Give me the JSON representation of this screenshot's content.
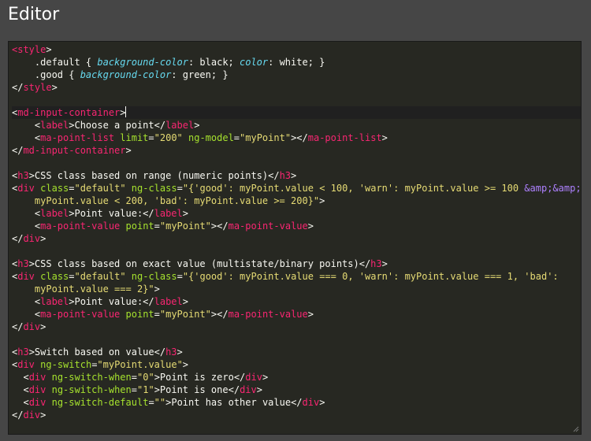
{
  "window": {
    "title": "Editor"
  },
  "editor": {
    "icons": {
      "resize_grip": "resize-grip-icon"
    },
    "colors": {
      "background": "#272822",
      "tag": "#f92672",
      "attribute": "#a6e22e",
      "string": "#e6db74",
      "property": "#66d9ef",
      "entity": "#ae81ff",
      "text": "#f8f8f2"
    },
    "active_line": 5,
    "lines": [
      [
        [
          "t",
          "<style"
        ],
        [
          "x",
          ">"
        ]
      ],
      [
        [
          "x",
          "    .default { "
        ],
        [
          "p",
          "background-color"
        ],
        [
          "x",
          ": black; "
        ],
        [
          "p",
          "color"
        ],
        [
          "x",
          ": white; }"
        ]
      ],
      [
        [
          "x",
          "    .good { "
        ],
        [
          "p",
          "background-color"
        ],
        [
          "x",
          ": green; }"
        ]
      ],
      [
        [
          "x",
          "</"
        ],
        [
          "t",
          "style"
        ],
        [
          "x",
          ">"
        ]
      ],
      [],
      [
        [
          "x",
          "<"
        ],
        [
          "t",
          "md-input-container"
        ],
        [
          "x",
          ">"
        ]
      ],
      [
        [
          "x",
          "    <"
        ],
        [
          "t",
          "label"
        ],
        [
          "x",
          ">Choose a point</"
        ],
        [
          "t",
          "label"
        ],
        [
          "x",
          ">"
        ]
      ],
      [
        [
          "x",
          "    <"
        ],
        [
          "t",
          "ma-point-list"
        ],
        [
          "x",
          " "
        ],
        [
          "a",
          "limit"
        ],
        [
          "x",
          "="
        ],
        [
          "s",
          "\"200\""
        ],
        [
          "x",
          " "
        ],
        [
          "a",
          "ng-model"
        ],
        [
          "x",
          "="
        ],
        [
          "s",
          "\"myPoint\""
        ],
        [
          "x",
          "></"
        ],
        [
          "t",
          "ma-point-list"
        ],
        [
          "x",
          ">"
        ]
      ],
      [
        [
          "x",
          "</"
        ],
        [
          "t",
          "md-input-container"
        ],
        [
          "x",
          ">"
        ]
      ],
      [],
      [
        [
          "x",
          "<"
        ],
        [
          "t",
          "h3"
        ],
        [
          "x",
          ">CSS class based on range (numeric points)</"
        ],
        [
          "t",
          "h3"
        ],
        [
          "x",
          ">"
        ]
      ],
      [
        [
          "x",
          "<"
        ],
        [
          "t",
          "div"
        ],
        [
          "x",
          " "
        ],
        [
          "a",
          "class"
        ],
        [
          "x",
          "="
        ],
        [
          "s",
          "\"default\""
        ],
        [
          "x",
          " "
        ],
        [
          "a",
          "ng-class"
        ],
        [
          "x",
          "="
        ],
        [
          "s",
          "\"{'good': myPoint.value < 100, 'warn': myPoint.value >= 100 "
        ],
        [
          "e",
          "&amp;&amp;"
        ]
      ],
      [
        [
          "s",
          "    myPoint.value < 200, 'bad': myPoint.value >= 200}\""
        ],
        [
          "x",
          ">"
        ]
      ],
      [
        [
          "x",
          "    <"
        ],
        [
          "t",
          "label"
        ],
        [
          "x",
          ">Point value:</"
        ],
        [
          "t",
          "label"
        ],
        [
          "x",
          ">"
        ]
      ],
      [
        [
          "x",
          "    <"
        ],
        [
          "t",
          "ma-point-value"
        ],
        [
          "x",
          " "
        ],
        [
          "a",
          "point"
        ],
        [
          "x",
          "="
        ],
        [
          "s",
          "\"myPoint\""
        ],
        [
          "x",
          "></"
        ],
        [
          "t",
          "ma-point-value"
        ],
        [
          "x",
          ">"
        ]
      ],
      [
        [
          "x",
          "</"
        ],
        [
          "t",
          "div"
        ],
        [
          "x",
          ">"
        ]
      ],
      [],
      [
        [
          "x",
          "<"
        ],
        [
          "t",
          "h3"
        ],
        [
          "x",
          ">CSS class based on exact value (multistate/binary points)</"
        ],
        [
          "t",
          "h3"
        ],
        [
          "x",
          ">"
        ]
      ],
      [
        [
          "x",
          "<"
        ],
        [
          "t",
          "div"
        ],
        [
          "x",
          " "
        ],
        [
          "a",
          "class"
        ],
        [
          "x",
          "="
        ],
        [
          "s",
          "\"default\""
        ],
        [
          "x",
          " "
        ],
        [
          "a",
          "ng-class"
        ],
        [
          "x",
          "="
        ],
        [
          "s",
          "\"{'good': myPoint.value === 0, 'warn': myPoint.value === 1, 'bad':"
        ]
      ],
      [
        [
          "s",
          "    myPoint.value === 2}\""
        ],
        [
          "x",
          ">"
        ]
      ],
      [
        [
          "x",
          "    <"
        ],
        [
          "t",
          "label"
        ],
        [
          "x",
          ">Point value:</"
        ],
        [
          "t",
          "label"
        ],
        [
          "x",
          ">"
        ]
      ],
      [
        [
          "x",
          "    <"
        ],
        [
          "t",
          "ma-point-value"
        ],
        [
          "x",
          " "
        ],
        [
          "a",
          "point"
        ],
        [
          "x",
          "="
        ],
        [
          "s",
          "\"myPoint\""
        ],
        [
          "x",
          "></"
        ],
        [
          "t",
          "ma-point-value"
        ],
        [
          "x",
          ">"
        ]
      ],
      [
        [
          "x",
          "</"
        ],
        [
          "t",
          "div"
        ],
        [
          "x",
          ">"
        ]
      ],
      [],
      [
        [
          "x",
          "<"
        ],
        [
          "t",
          "h3"
        ],
        [
          "x",
          ">Switch based on value</"
        ],
        [
          "t",
          "h3"
        ],
        [
          "x",
          ">"
        ]
      ],
      [
        [
          "x",
          "<"
        ],
        [
          "t",
          "div"
        ],
        [
          "x",
          " "
        ],
        [
          "a",
          "ng-switch"
        ],
        [
          "x",
          "="
        ],
        [
          "s",
          "\"myPoint.value\""
        ],
        [
          "x",
          ">"
        ]
      ],
      [
        [
          "x",
          "  <"
        ],
        [
          "t",
          "div"
        ],
        [
          "x",
          " "
        ],
        [
          "a",
          "ng-switch-when"
        ],
        [
          "x",
          "="
        ],
        [
          "s",
          "\"0\""
        ],
        [
          "x",
          ">Point is zero</"
        ],
        [
          "t",
          "div"
        ],
        [
          "x",
          ">"
        ]
      ],
      [
        [
          "x",
          "  <"
        ],
        [
          "t",
          "div"
        ],
        [
          "x",
          " "
        ],
        [
          "a",
          "ng-switch-when"
        ],
        [
          "x",
          "="
        ],
        [
          "s",
          "\"1\""
        ],
        [
          "x",
          ">Point is one</"
        ],
        [
          "t",
          "div"
        ],
        [
          "x",
          ">"
        ]
      ],
      [
        [
          "x",
          "  <"
        ],
        [
          "t",
          "div"
        ],
        [
          "x",
          " "
        ],
        [
          "a",
          "ng-switch-default"
        ],
        [
          "x",
          "="
        ],
        [
          "s",
          "\"\""
        ],
        [
          "x",
          ">Point has other value</"
        ],
        [
          "t",
          "div"
        ],
        [
          "x",
          ">"
        ]
      ],
      [
        [
          "x",
          "</"
        ],
        [
          "t",
          "div"
        ],
        [
          "x",
          ">"
        ]
      ]
    ]
  }
}
